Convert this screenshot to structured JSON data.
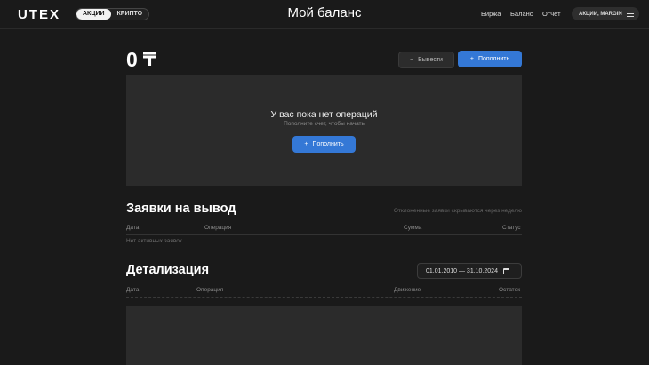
{
  "header": {
    "logo": "UTEX",
    "segments": [
      "АКЦИИ",
      "КРИПТО"
    ],
    "title": "Мой баланс",
    "nav": [
      "Биржа",
      "Баланс",
      "Отчет"
    ],
    "account_label": "АКЦИИ, MARGIN"
  },
  "balance": {
    "amount": "0",
    "currency_symbol": "₸",
    "withdraw_label": "Вывести",
    "deposit_label": "Пополнить"
  },
  "empty_state": {
    "title": "У вас пока нет операций",
    "subtitle": "Пополните счет, чтобы начать",
    "button_label": "Пополнить"
  },
  "withdrawals": {
    "title": "Заявки на вывод",
    "hint": "Отклоненные заявки скрываются через неделю",
    "columns": [
      "Дата",
      "Операция",
      "Сумма",
      "Статус"
    ],
    "empty": "Нет активных заявок"
  },
  "details": {
    "title": "Детализация",
    "date_range": "01.01.2010 — 31.10.2024",
    "columns": [
      "Дата",
      "Операция",
      "Движение",
      "Остаток"
    ]
  },
  "colors": {
    "accent": "#3478d6",
    "background": "#1a1a1a",
    "panel": "#2b2b2b"
  }
}
